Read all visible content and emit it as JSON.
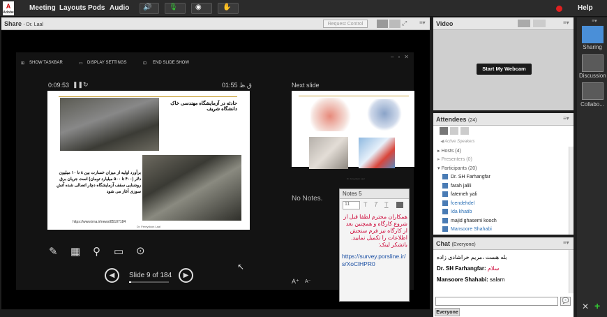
{
  "menubar": {
    "items": [
      "Meeting",
      "Layouts",
      "Pods",
      "Audio"
    ],
    "help": "Help"
  },
  "share_pod": {
    "title": "Share",
    "presenter": "- Dr. Laal",
    "request_control": "Request Control"
  },
  "presenter_bar": {
    "show_taskbar": "SHOW TASKBAR",
    "display_settings": "DISPLAY SETTINGS",
    "end_slide_show": "END SLIDE SHOW"
  },
  "presenter_view": {
    "elapsed": "0:09:53",
    "clock": "ق.ظ 01:55",
    "next_slide_label": "Next slide",
    "no_notes": "No Notes.",
    "slide_counter": "Slide 9 of 184"
  },
  "current_slide": {
    "heading": "حادثه در آزمایشگاه مهندسی خاک دانشگاه شریف",
    "body": "برآورد اولیه از میزان خسارت بین ۸ تا ۱۰ میلیون دلار (۴۰۰ تا ۵۰۰ میلیارد تومان) است جریان برق روشنایی سقف آزمایشگاه دچار اتصالی شده آتش سوزی آغاز می شود",
    "url": "https://www.irna.ir/news/85107184",
    "author": "Dr. Fereydoon Laal"
  },
  "next_slide": {
    "author": "Dr. Fereydoon Laal"
  },
  "notes_pod": {
    "title": "Notes",
    "font_size": "11",
    "text": "همکاران محترم لطفا قبل از شروع کارگاه و همچنین بعد از کارگاه نیز فرم سنجش اطلاعات را تکمیل نمایید. باتشکر لینک:",
    "link": "https://survey.porsline.ir/s/XoClHPR0"
  },
  "video_pod": {
    "title": "Video",
    "webcam_button": "Start My Webcam"
  },
  "attendees_pod": {
    "title": "Attendees",
    "count": "(24)",
    "active_speakers": "Active Speakers",
    "groups": [
      {
        "label": "Hosts (4)"
      },
      {
        "label": "Presenters (0)"
      },
      {
        "label": "Participants (20)"
      }
    ],
    "participants": [
      "Dr. SH Farhangfar",
      "farah jalili",
      "fatemeh yali",
      "fcendehdel",
      "Ida khatib",
      "majid ghasemi kooch",
      "Mansoore Shahabi"
    ]
  },
  "chat_pod": {
    "title": "Chat",
    "scope": "(Everyone)",
    "messages": [
      {
        "sender": "",
        "text": "بله هست ،مریم خراشادی زاده"
      },
      {
        "sender": "Dr. SH Farhangfar:",
        "text": "سلام"
      },
      {
        "sender": "Mansoore Shahabi:",
        "text": "salam"
      }
    ],
    "recipient_tab": "Everyone"
  },
  "layouts": [
    {
      "label": "Sharing"
    },
    {
      "label": "Discussion"
    },
    {
      "label": "Collabo..."
    }
  ],
  "colors": {
    "accent": "#2a6fb5",
    "chat_red": "#cc0033",
    "record": "#e02020"
  }
}
